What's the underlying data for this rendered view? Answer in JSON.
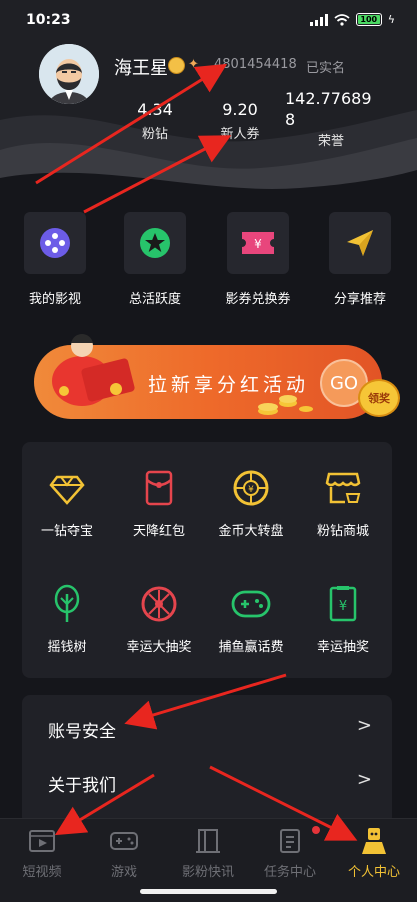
{
  "status": {
    "time": "10:23",
    "battery": "100"
  },
  "profile": {
    "username": "海王星",
    "user_id": "4801454418",
    "verified": "已实名",
    "stats": [
      {
        "value": "4.34",
        "label": "粉钻"
      },
      {
        "value": "9.20",
        "label": "新人券"
      },
      {
        "value": "142.77689\n8",
        "label": "荣誉"
      }
    ]
  },
  "quick_actions": [
    {
      "label": "我的影视",
      "icon": "film-reel-icon"
    },
    {
      "label": "总活跃度",
      "icon": "star-icon"
    },
    {
      "label": "影券兑换券",
      "icon": "ticket-icon"
    },
    {
      "label": "分享推荐",
      "icon": "paper-plane-icon"
    }
  ],
  "banner": {
    "text": "拉新享分红活动",
    "go": "GO",
    "reward": "领奖"
  },
  "features": [
    {
      "label": "一钻夺宝",
      "icon": "diamond-icon"
    },
    {
      "label": "天降红包",
      "icon": "red-packet-icon"
    },
    {
      "label": "金币大转盘",
      "icon": "wheel-icon"
    },
    {
      "label": "粉钻商城",
      "icon": "shop-icon"
    },
    {
      "label": "摇钱树",
      "icon": "tree-icon"
    },
    {
      "label": "幸运大抽奖",
      "icon": "lottery-wheel-icon"
    },
    {
      "label": "捕鱼赢话费",
      "icon": "gamepad-icon"
    },
    {
      "label": "幸运抽奖",
      "icon": "lucky-draw-icon"
    }
  ],
  "menu": [
    {
      "label": "账号安全",
      "arrow": ">"
    },
    {
      "label": "关于我们",
      "arrow": ">"
    }
  ],
  "tabs": [
    {
      "label": "短视频",
      "icon": "video-icon",
      "active": false
    },
    {
      "label": "游戏",
      "icon": "gamepad-icon",
      "active": false
    },
    {
      "label": "影粉快讯",
      "icon": "news-icon",
      "active": false
    },
    {
      "label": "任务中心",
      "icon": "task-icon",
      "active": false
    },
    {
      "label": "个人中心",
      "icon": "user-center-icon",
      "active": true
    }
  ],
  "colors": {
    "accent": "#f2c235",
    "card": "#202127",
    "background": "#15161b",
    "banner": "#ee6a2a"
  }
}
